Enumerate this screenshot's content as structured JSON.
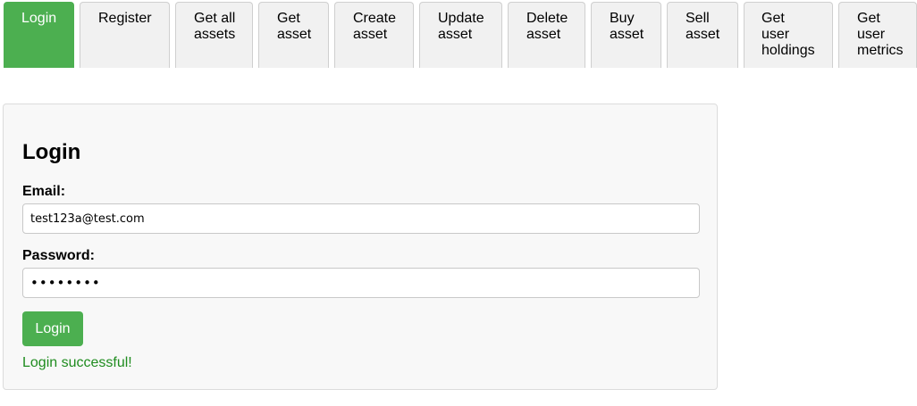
{
  "tabs": [
    {
      "label": "Login",
      "active": true
    },
    {
      "label": "Register",
      "active": false
    },
    {
      "label": "Get all\nassets",
      "active": false
    },
    {
      "label": "Get\nasset",
      "active": false
    },
    {
      "label": "Create\nasset",
      "active": false
    },
    {
      "label": "Update\nasset",
      "active": false
    },
    {
      "label": "Delete\nasset",
      "active": false
    },
    {
      "label": "Buy\nasset",
      "active": false
    },
    {
      "label": "Sell\nasset",
      "active": false
    },
    {
      "label": "Get\nuser\nholdings",
      "active": false
    },
    {
      "label": "Get\nuser\nmetrics",
      "active": false
    }
  ],
  "form": {
    "title": "Login",
    "email_label": "Email:",
    "email_value": "test123a@test.com",
    "password_label": "Password:",
    "password_value": "••••••••",
    "submit_label": "Login",
    "status_message": "Login successful!"
  },
  "colors": {
    "accent": "#4caf50",
    "success_text": "#1f8c1f",
    "tab_background": "#f1f1f1"
  }
}
